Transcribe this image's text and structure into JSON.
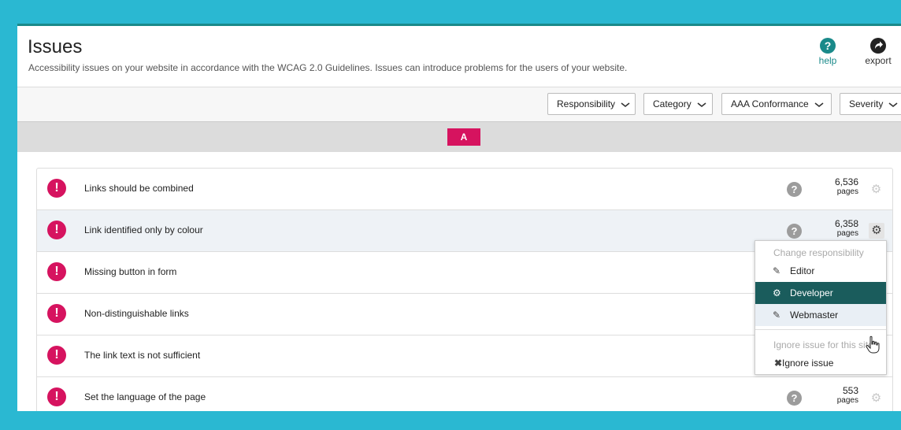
{
  "header": {
    "title": "Issues",
    "description": "Accessibility issues on your website in accordance with the WCAG 2.0 Guidelines. Issues can introduce problems for the users of your website.",
    "help_label": "help",
    "export_label": "export",
    "help_icon": "question-circle-icon",
    "export_icon": "share-arrow-icon"
  },
  "filters": {
    "responsibility": "Responsibility",
    "category": "Category",
    "conformance": "AAA Conformance",
    "severity": "Severity"
  },
  "level": {
    "badge": "A",
    "color": "#d6135f"
  },
  "issues": [
    {
      "title": "Links should be combined",
      "count": "6,536",
      "unit": "pages"
    },
    {
      "title": "Link identified only by colour",
      "count": "6,358",
      "unit": "pages"
    },
    {
      "title": "Missing button in form",
      "count": "",
      "unit": ""
    },
    {
      "title": "Non-distinguishable links",
      "count": "",
      "unit": ""
    },
    {
      "title": "The link text is not sufficient",
      "count": "",
      "unit": ""
    },
    {
      "title": "Set the language of the page",
      "count": "553",
      "unit": "pages"
    }
  ],
  "menu": {
    "heading_responsibility": "Change responsibility",
    "items": [
      {
        "label": "Editor",
        "icon": "editor-icon"
      },
      {
        "label": "Developer",
        "icon": "developer-icon"
      },
      {
        "label": "Webmaster",
        "icon": "webmaster-icon"
      }
    ],
    "heading_ignore": "Ignore issue for this site",
    "ignore_label": "Ignore issue"
  },
  "colors": {
    "accent": "#1a8a8a",
    "severity": "#d6135f",
    "selected_menu": "#1a5c5c",
    "frame_bg": "#2ab8d2"
  }
}
